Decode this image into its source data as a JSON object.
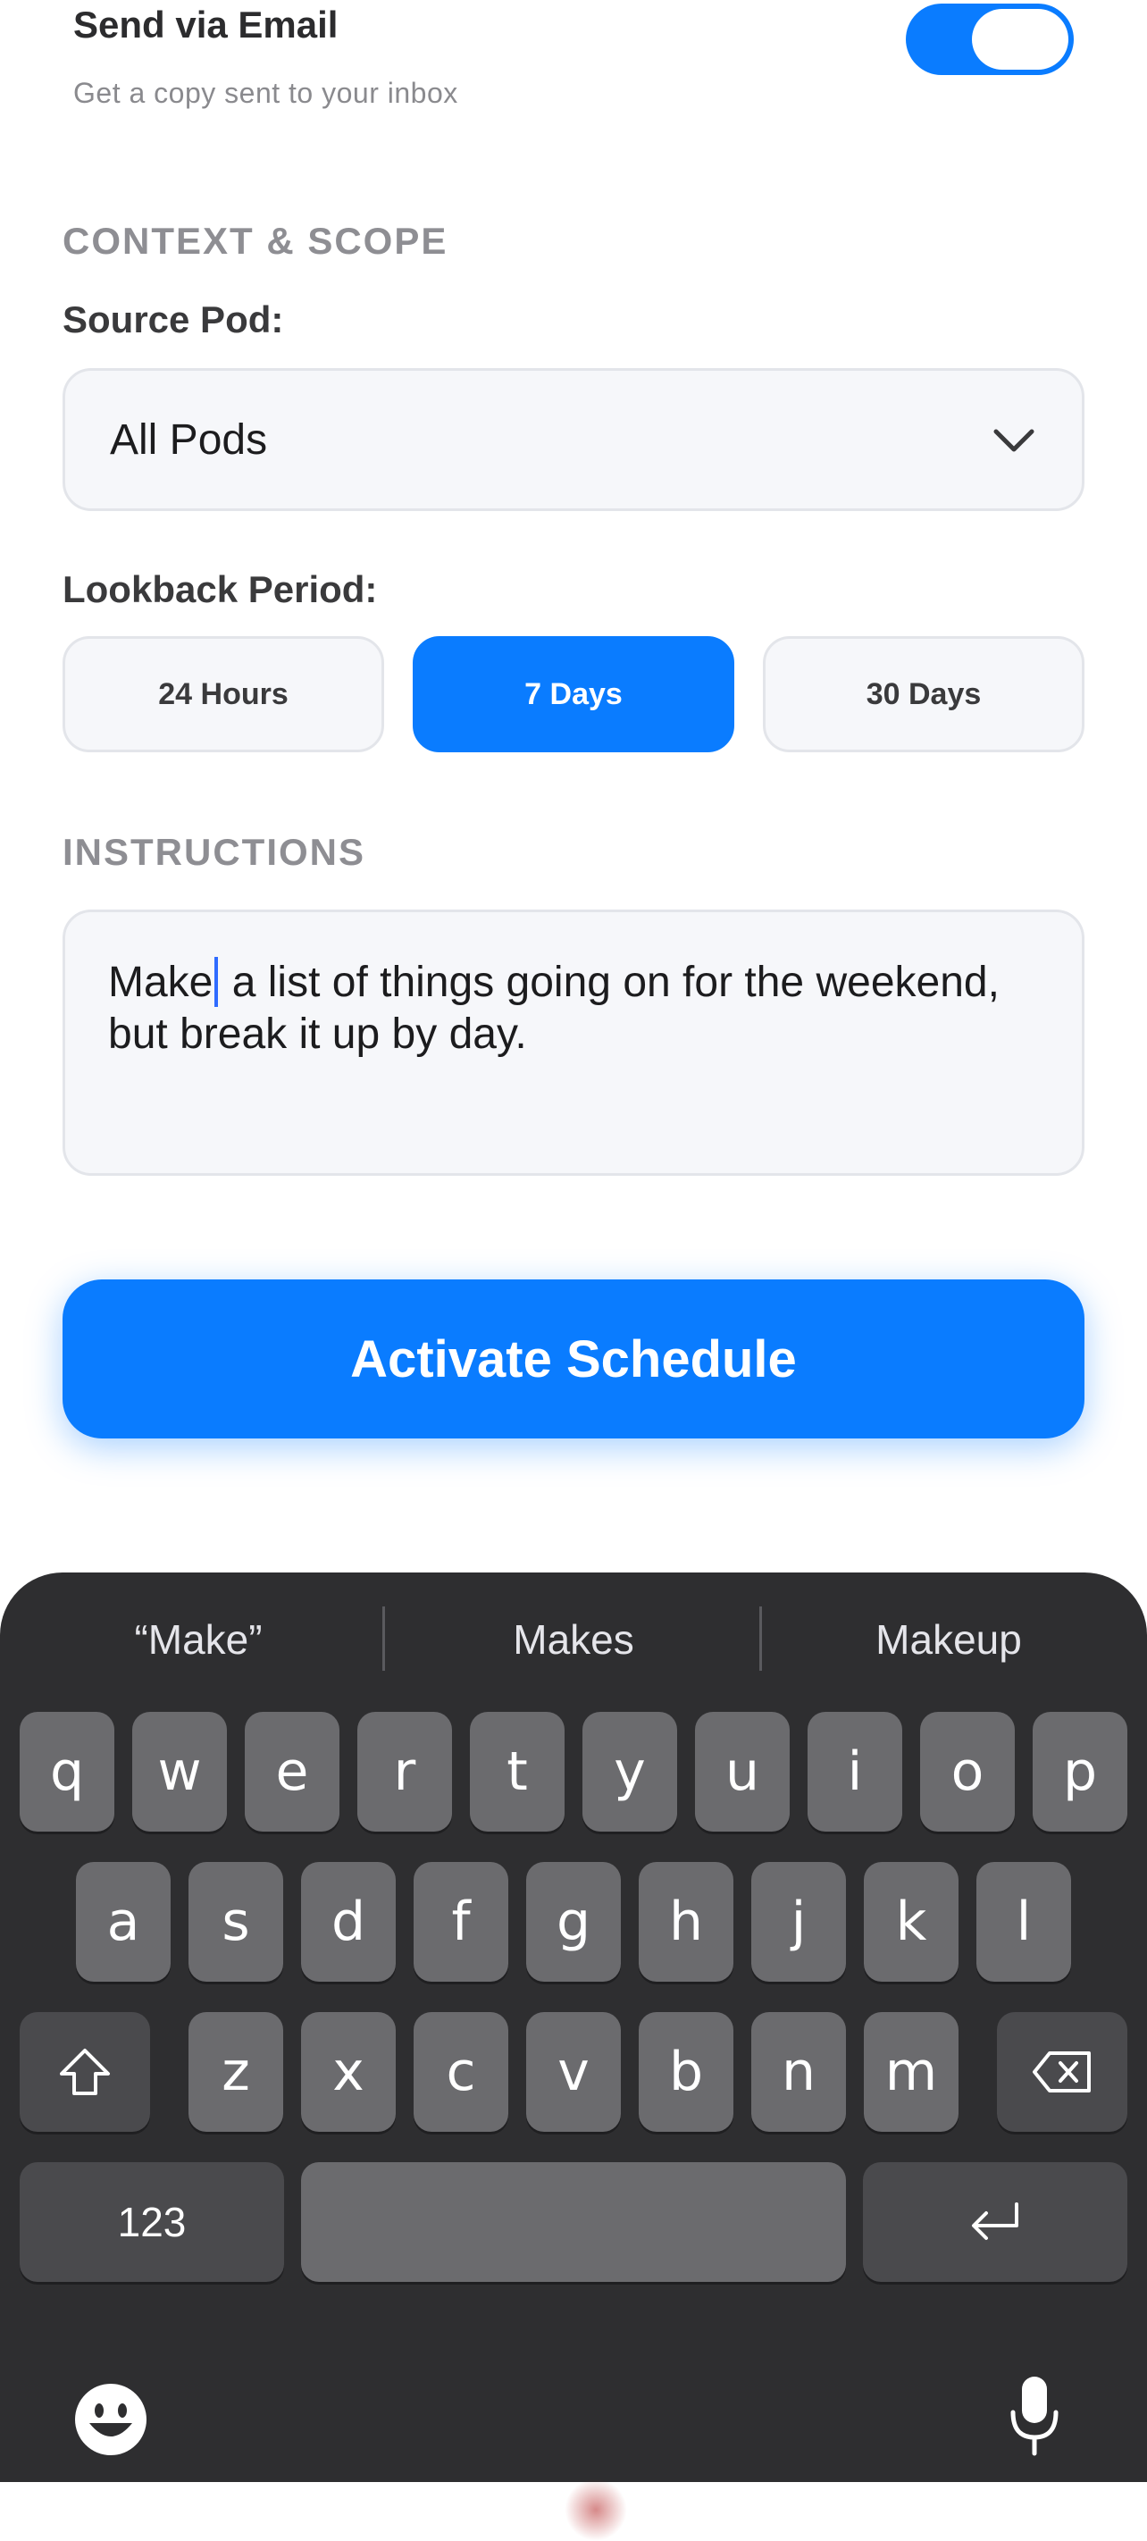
{
  "email": {
    "title": "Send via Email",
    "subtitle": "Get a copy sent to your inbox",
    "toggle_on": true
  },
  "context": {
    "section_label": "CONTEXT & SCOPE",
    "source_label": "Source Pod:",
    "source_value": "All Pods",
    "lookback_label": "Lookback Period:",
    "lookback_options": [
      "24 Hours",
      "7 Days",
      "30 Days"
    ],
    "lookback_selected": "7 Days"
  },
  "instructions": {
    "section_label": "INSTRUCTIONS",
    "text_before_caret": "Make",
    "text_after_caret": " a list of things going on for the weekend, but break it up by day."
  },
  "action": {
    "activate_label": "Activate Schedule"
  },
  "colors": {
    "accent": "#0a7cff",
    "keyboard_bg": "#2e2e30",
    "key_bg": "#6b6b6e"
  },
  "keyboard": {
    "suggestions": [
      "“Make”",
      "Makes",
      "Makeup"
    ],
    "row1": [
      "q",
      "w",
      "e",
      "r",
      "t",
      "y",
      "u",
      "i",
      "o",
      "p"
    ],
    "row2": [
      "a",
      "s",
      "d",
      "f",
      "g",
      "h",
      "j",
      "k",
      "l"
    ],
    "row3": [
      "z",
      "x",
      "c",
      "v",
      "b",
      "n",
      "m"
    ],
    "numbers_label": "123",
    "icons": [
      "shift-icon",
      "backspace-icon",
      "return-icon",
      "emoji-icon",
      "microphone-icon"
    ]
  }
}
